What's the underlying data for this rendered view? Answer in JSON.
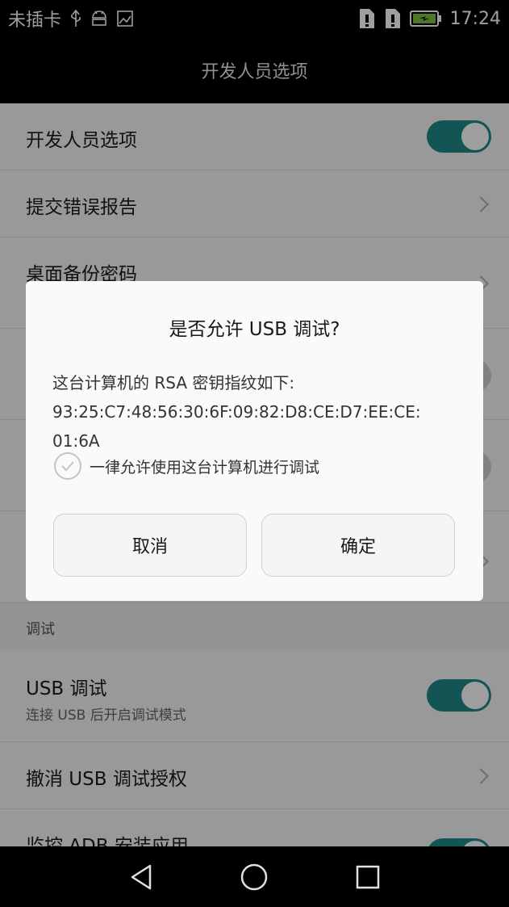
{
  "status_bar": {
    "carrier": "未插卡",
    "time": "17:24",
    "icons": [
      "usb-icon",
      "android-debug-icon",
      "image-icon",
      "sim1-icon",
      "sim2-icon",
      "battery-icon"
    ]
  },
  "title_bar": {
    "title": "开发人员选项"
  },
  "settings": {
    "developer_options": {
      "label": "开发人员选项",
      "toggle": "on"
    },
    "bug_report": {
      "label": "提交错误报告"
    },
    "desktop_backup_password": {
      "label": "桌面备份密码"
    },
    "debug_section": {
      "label": "调试"
    },
    "usb_debugging": {
      "label": "USB 调试",
      "sublabel": "连接 USB 后开启调试模式",
      "toggle": "on"
    },
    "revoke_usb_auth": {
      "label": "撤消 USB 调试授权"
    },
    "monitor_adb": {
      "label": "监控 ADB 安装应用",
      "toggle": "on"
    }
  },
  "dialog": {
    "title": "是否允许 USB 调试?",
    "body_line1": "这台计算机的 RSA 密钥指纹如下:",
    "body_line2": "93:25:C7:48:56:30:6F:09:82:D8:CE:D7:EE:CE:",
    "body_line3": "01:6A",
    "always_allow_label": "一律允许使用这台计算机进行调试",
    "always_allow_checked": false,
    "cancel_label": "取消",
    "ok_label": "确定"
  },
  "colors": {
    "accent": "#1f8a8a",
    "status_bar": "#000000",
    "dialog_bg": "#fafafa"
  }
}
